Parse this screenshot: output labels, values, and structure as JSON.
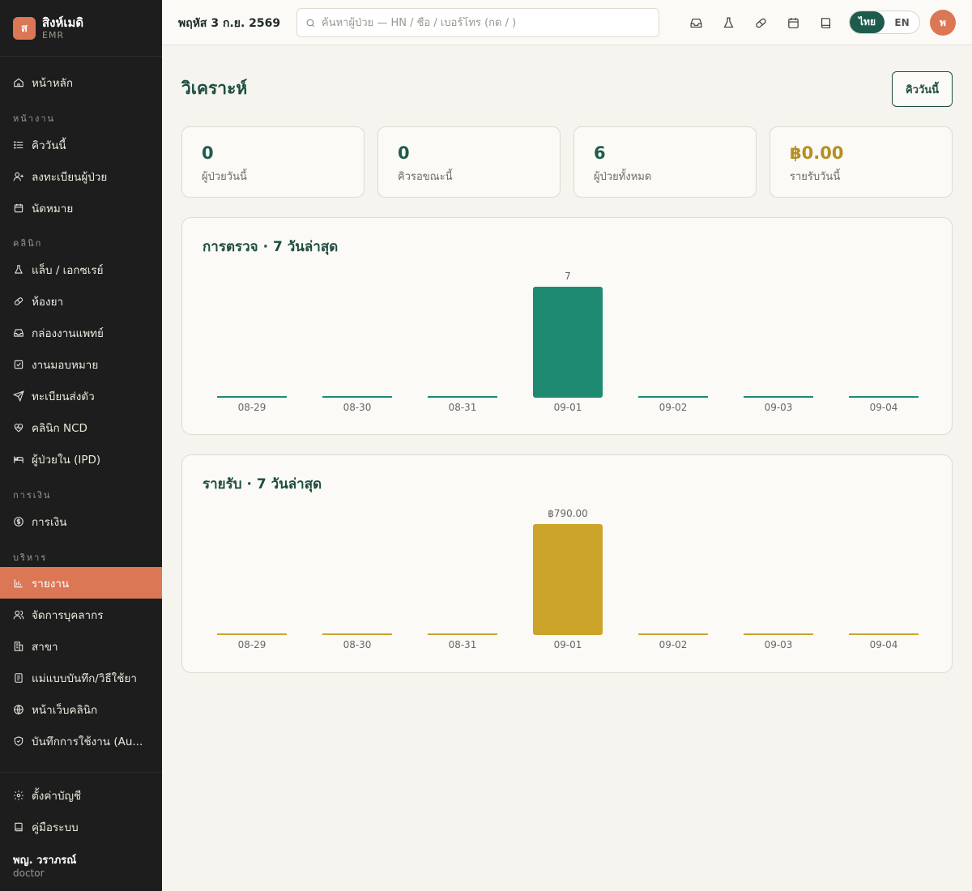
{
  "brand": {
    "logo": "ส",
    "name": "สิงห์เมดิ",
    "sub": "EMR"
  },
  "sidebar": {
    "home": "หน้าหลัก",
    "sections": [
      "หน้างาน",
      "คลินิก",
      "การเงิน",
      "บริหาร"
    ],
    "items": [
      {
        "label": "คิววันนี้",
        "icon": "list-icon"
      },
      {
        "label": "ลงทะเบียนผู้ป่วย",
        "icon": "user-plus-icon"
      },
      {
        "label": "นัดหมาย",
        "icon": "calendar-icon"
      },
      {
        "label": "แล็บ / เอกซเรย์",
        "icon": "flask-icon"
      },
      {
        "label": "ห้องยา",
        "icon": "pill-icon"
      },
      {
        "label": "กล่องงานแพทย์",
        "icon": "inbox-icon"
      },
      {
        "label": "งานมอบหมาย",
        "icon": "checkbox-icon"
      },
      {
        "label": "ทะเบียนส่งตัว",
        "icon": "send-icon"
      },
      {
        "label": "คลินิก NCD",
        "icon": "heart-pulse-icon"
      },
      {
        "label": "ผู้ป่วยใน (IPD)",
        "icon": "bed-icon"
      },
      {
        "label": "การเงิน",
        "icon": "dollar-icon"
      },
      {
        "label": "รายงาน",
        "icon": "bar-chart-icon",
        "active": true
      },
      {
        "label": "จัดการบุคลากร",
        "icon": "users-icon"
      },
      {
        "label": "สาขา",
        "icon": "building-icon"
      },
      {
        "label": "แม่แบบบันทึก/วิธีใช้ยา",
        "icon": "document-icon"
      },
      {
        "label": "หน้าเว็บคลินิก",
        "icon": "globe-icon"
      },
      {
        "label": "บันทึกการใช้งาน (Au...",
        "icon": "shield-check-icon"
      }
    ],
    "settings": "ตั้งค่าบัญชี",
    "manual": "คู่มือระบบ",
    "user_name": "พญ. วราภรณ์",
    "user_role": "doctor"
  },
  "header": {
    "date": "พฤหัส 3 ก.ย. 2569",
    "search_placeholder": "ค้นหาผู้ป่วย — HN / ชื่อ / เบอร์โทร (กด / )",
    "lang_th": "ไทย",
    "lang_en": "EN",
    "avatar": "พ"
  },
  "main": {
    "title": "วิเคราะห์",
    "queue_button": "คิววันนี้",
    "stats": [
      {
        "value": "0",
        "label": "ผู้ป่วยวันนี้"
      },
      {
        "value": "0",
        "label": "คิวรอขณะนี้"
      },
      {
        "value": "6",
        "label": "ผู้ป่วยทั้งหมด"
      },
      {
        "value": "฿0.00",
        "label": "รายรับวันนี้"
      }
    ]
  },
  "colors": {
    "primary": "#1d5c4c",
    "accent": "#dc7756",
    "teal_bar": "#1e8a72",
    "gold_bar": "#cca42a",
    "sidebar_bg": "#1d1d1d"
  },
  "chart_data": [
    {
      "type": "bar",
      "title": "การตรวจ · 7 วันล่าสุด",
      "categories": [
        "08-29",
        "08-30",
        "08-31",
        "09-01",
        "09-02",
        "09-03",
        "09-04"
      ],
      "values": [
        0,
        0,
        0,
        7,
        0,
        0,
        0
      ],
      "value_labels": [
        "",
        "",
        "",
        "7",
        "",
        "",
        ""
      ],
      "color": "#1e8a72"
    },
    {
      "type": "bar",
      "title": "รายรับ · 7 วันล่าสุด",
      "categories": [
        "08-29",
        "08-30",
        "08-31",
        "09-01",
        "09-02",
        "09-03",
        "09-04"
      ],
      "values": [
        0,
        0,
        0,
        790,
        0,
        0,
        0
      ],
      "value_labels": [
        "",
        "",
        "",
        "฿790.00",
        "",
        "",
        ""
      ],
      "color": "#cca42a"
    }
  ]
}
